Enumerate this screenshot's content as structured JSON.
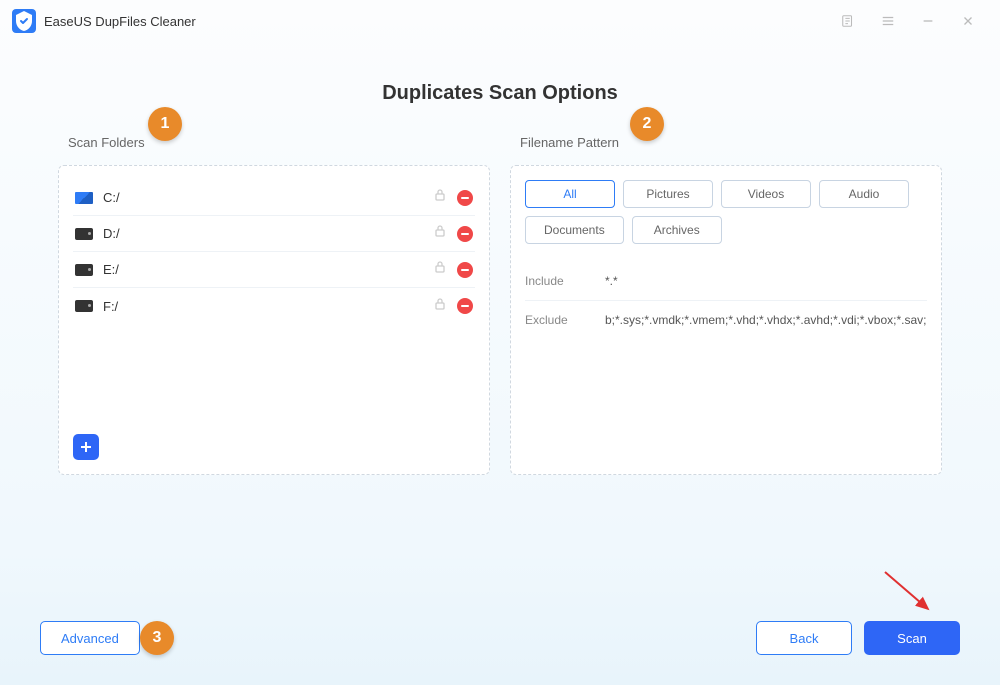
{
  "app": {
    "title": "EaseUS DupFiles Cleaner"
  },
  "page": {
    "title": "Duplicates Scan Options"
  },
  "scan_folders": {
    "label": "Scan Folders",
    "items": [
      {
        "name": "C:/",
        "icon": "win"
      },
      {
        "name": "D:/",
        "icon": "hdd"
      },
      {
        "name": "E:/",
        "icon": "hdd"
      },
      {
        "name": "F:/",
        "icon": "hdd"
      }
    ]
  },
  "filename_pattern": {
    "label": "Filename Pattern",
    "buttons": [
      {
        "label": "All",
        "active": true
      },
      {
        "label": "Pictures",
        "active": false
      },
      {
        "label": "Videos",
        "active": false
      },
      {
        "label": "Audio",
        "active": false
      },
      {
        "label": "Documents",
        "active": false
      },
      {
        "label": "Archives",
        "active": false
      }
    ],
    "include": {
      "label": "Include",
      "value": "*.*"
    },
    "exclude": {
      "label": "Exclude",
      "value": "b;*.sys;*.vmdk;*.vmem;*.vhd;*.vhdx;*.avhd;*.vdi;*.vbox;*.sav;"
    }
  },
  "steps": {
    "one": "1",
    "two": "2",
    "three": "3"
  },
  "footer": {
    "advanced": "Advanced",
    "back": "Back",
    "scan": "Scan"
  }
}
